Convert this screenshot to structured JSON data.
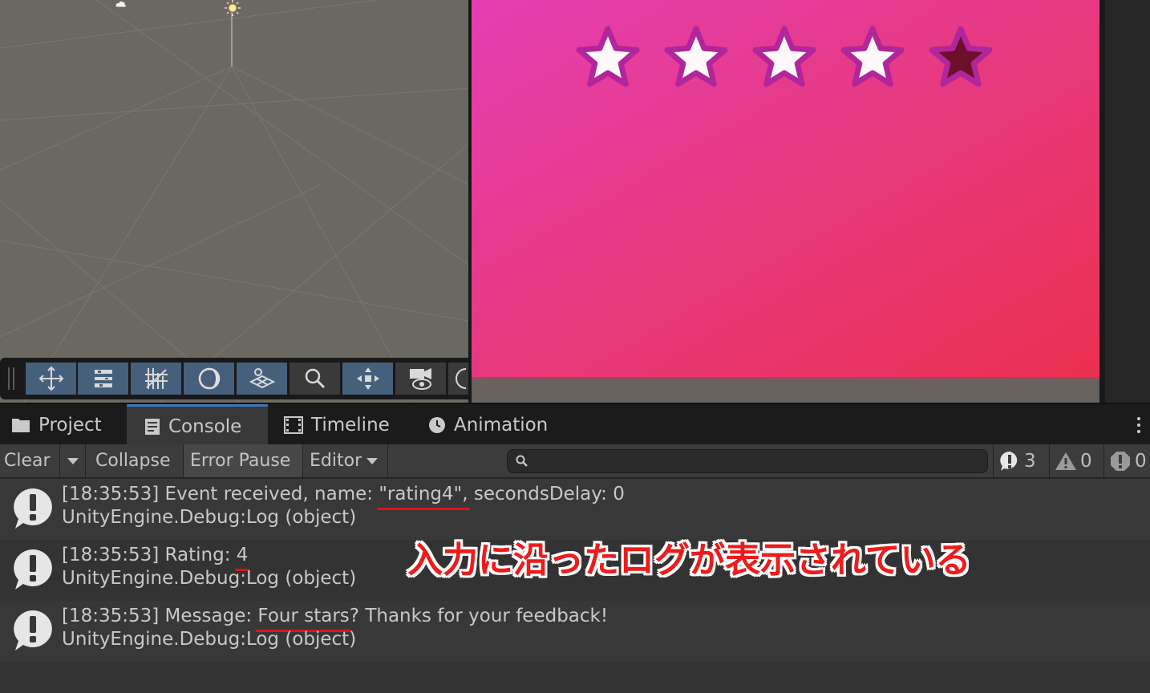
{
  "colors": {
    "scene_bg": "#6b6761",
    "game_gradient": [
      "#e53db3",
      "#e73a84",
      "#ea3050"
    ],
    "star_filled": "#fff8fa",
    "star_empty": "#6b0f2b",
    "star_outline": "#b1269a",
    "accent_tab": "#3a79bb",
    "annotation": "#ee1b1b"
  },
  "scene": {
    "toolbar_icons": [
      "move-tool-icon",
      "transform-tool-icon",
      "grid-snap-icon",
      "view-toggle-icon",
      "layers-icon",
      "search-icon",
      "pivot-icon",
      "camera-view-icon",
      "more-icon"
    ]
  },
  "game": {
    "rating": {
      "value": 4,
      "max": 5
    }
  },
  "tabs": [
    {
      "label": "Project",
      "icon": "folder-icon"
    },
    {
      "label": "Console",
      "icon": "console-icon",
      "active": true
    },
    {
      "label": "Timeline",
      "icon": "timeline-icon"
    },
    {
      "label": "Animation",
      "icon": "clock-icon"
    }
  ],
  "console_toolbar": {
    "clear": "Clear",
    "collapse": "Collapse",
    "error_pause": "Error Pause",
    "editor": "Editor",
    "search_placeholder": "",
    "counts": {
      "info": "3",
      "warning": "0",
      "error": "0"
    }
  },
  "logs": [
    {
      "prefix": "[18:35:53] Event received, name: ",
      "highlight": "\"rating4\",",
      "suffix": " secondsDelay: 0",
      "trace": "UnityEngine.Debug:Log (object)"
    },
    {
      "prefix": "[18:35:53] Rating: ",
      "highlight": "4",
      "suffix": "",
      "trace": "UnityEngine.Debug:Log (object)"
    },
    {
      "prefix": "[18:35:53] Message: ",
      "highlight": "Four stars",
      "suffix": "? Thanks for your feedback!",
      "trace": "UnityEngine.Debug:Log (object)"
    }
  ],
  "annotation": "入力に沿ったログが表示されている"
}
